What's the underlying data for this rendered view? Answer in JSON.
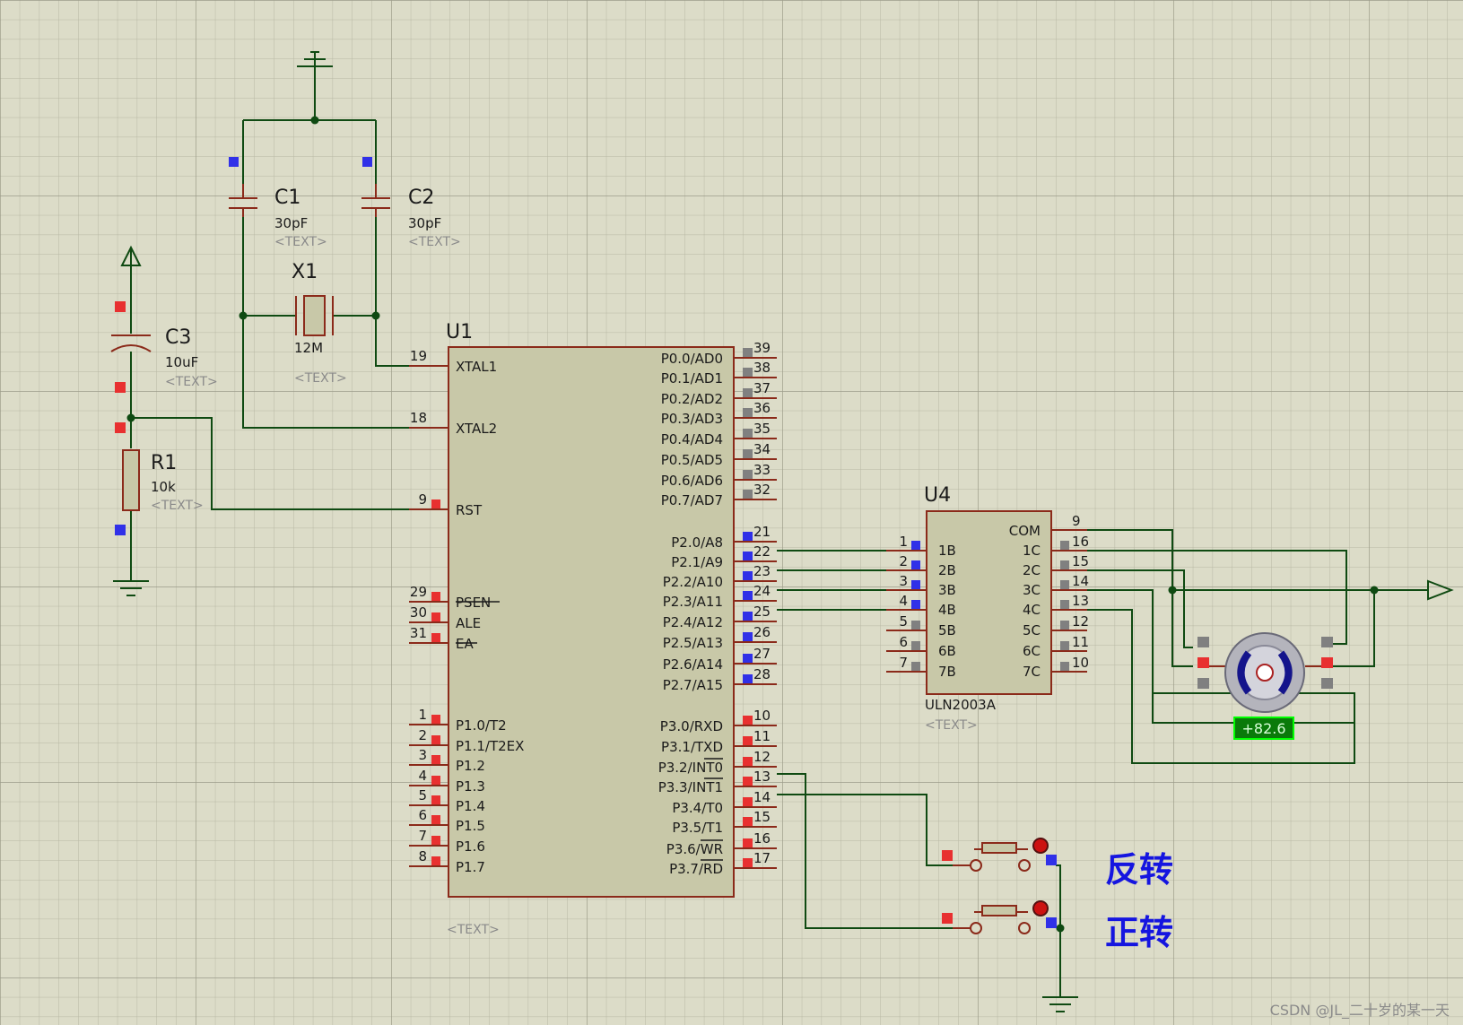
{
  "components": {
    "c1": {
      "ref": "C1",
      "value": "30pF",
      "text": "<TEXT>"
    },
    "c2": {
      "ref": "C2",
      "value": "30pF",
      "text": "<TEXT>"
    },
    "c3": {
      "ref": "C3",
      "value": "10uF",
      "text": "<TEXT>"
    },
    "x1": {
      "ref": "X1",
      "value": "12M",
      "text": "<TEXT>"
    },
    "r1": {
      "ref": "R1",
      "value": "10k",
      "text": "<TEXT>"
    },
    "u1": {
      "ref": "U1",
      "text": "<TEXT>"
    },
    "u4": {
      "ref": "U4",
      "value": "ULN2003A",
      "text": "<TEXT>"
    },
    "motor": {
      "readout": "+82.6"
    }
  },
  "u1_left": [
    {
      "num": "19",
      "name": "XTAL1"
    },
    {
      "num": "18",
      "name": "XTAL2"
    },
    {
      "num": "9",
      "name": "RST"
    },
    {
      "num": "29",
      "name": "PSEN"
    },
    {
      "num": "30",
      "name": "ALE"
    },
    {
      "num": "31",
      "name": "EA"
    },
    {
      "num": "1",
      "name": "P1.0/T2"
    },
    {
      "num": "2",
      "name": "P1.1/T2EX"
    },
    {
      "num": "3",
      "name": "P1.2"
    },
    {
      "num": "4",
      "name": "P1.3"
    },
    {
      "num": "5",
      "name": "P1.4"
    },
    {
      "num": "6",
      "name": "P1.5"
    },
    {
      "num": "7",
      "name": "P1.6"
    },
    {
      "num": "8",
      "name": "P1.7"
    }
  ],
  "u1_right": [
    {
      "num": "39",
      "name": "P0.0/AD0"
    },
    {
      "num": "38",
      "name": "P0.1/AD1"
    },
    {
      "num": "37",
      "name": "P0.2/AD2"
    },
    {
      "num": "36",
      "name": "P0.3/AD3"
    },
    {
      "num": "35",
      "name": "P0.4/AD4"
    },
    {
      "num": "34",
      "name": "P0.5/AD5"
    },
    {
      "num": "33",
      "name": "P0.6/AD6"
    },
    {
      "num": "32",
      "name": "P0.7/AD7"
    },
    {
      "num": "21",
      "name": "P2.0/A8"
    },
    {
      "num": "22",
      "name": "P2.1/A9"
    },
    {
      "num": "23",
      "name": "P2.2/A10"
    },
    {
      "num": "24",
      "name": "P2.3/A11"
    },
    {
      "num": "25",
      "name": "P2.4/A12"
    },
    {
      "num": "26",
      "name": "P2.5/A13"
    },
    {
      "num": "27",
      "name": "P2.6/A14"
    },
    {
      "num": "28",
      "name": "P2.7/A15"
    },
    {
      "num": "10",
      "name": "P3.0/RXD"
    },
    {
      "num": "11",
      "name": "P3.1/TXD"
    },
    {
      "num": "12",
      "name": "P3.2/INT0"
    },
    {
      "num": "13",
      "name": "P3.3/INT1"
    },
    {
      "num": "14",
      "name": "P3.4/T0"
    },
    {
      "num": "15",
      "name": "P3.5/T1"
    },
    {
      "num": "16",
      "name": "P3.6/WR"
    },
    {
      "num": "17",
      "name": "P3.7/RD"
    }
  ],
  "u4_left": [
    {
      "num": "1",
      "name": "1B"
    },
    {
      "num": "2",
      "name": "2B"
    },
    {
      "num": "3",
      "name": "3B"
    },
    {
      "num": "4",
      "name": "4B"
    },
    {
      "num": "5",
      "name": "5B"
    },
    {
      "num": "6",
      "name": "6B"
    },
    {
      "num": "7",
      "name": "7B"
    }
  ],
  "u4_right": [
    {
      "num": "9",
      "name": "COM"
    },
    {
      "num": "16",
      "name": "1C"
    },
    {
      "num": "15",
      "name": "2C"
    },
    {
      "num": "14",
      "name": "3C"
    },
    {
      "num": "13",
      "name": "4C"
    },
    {
      "num": "12",
      "name": "5C"
    },
    {
      "num": "11",
      "name": "6C"
    },
    {
      "num": "10",
      "name": "7C"
    }
  ],
  "labels": {
    "reverse": "反转",
    "forward": "正转",
    "watermark": "CSDN @JL_二十岁的某一天"
  },
  "colors": {
    "background": "#dcdcc8",
    "wire": "#0f4a12",
    "body": "#c8c8a8",
    "outline": "#8b2a1a",
    "pin_red": "#e83030",
    "pin_blue": "#3030e8",
    "pin_gray": "#808080",
    "label_blue": "#1515e0",
    "readout": "#0a7a0a"
  }
}
